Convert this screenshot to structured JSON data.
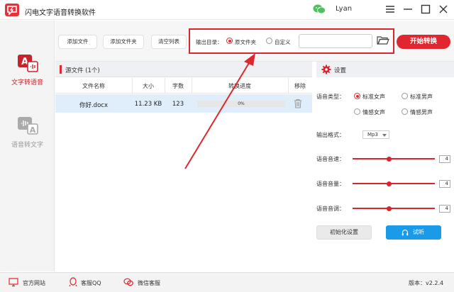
{
  "window": {
    "title": "闪电文字语音转换软件",
    "user_name": "Lyan"
  },
  "nav": {
    "items": [
      {
        "label": "文字转语音",
        "active": true
      },
      {
        "label": "语音转文字",
        "active": false
      }
    ]
  },
  "toolbar": {
    "add_file": "添加文件",
    "add_folder": "添加文件夹",
    "clear_list": "清空列表",
    "output_label": "输出目录：",
    "option_source": "原文件夹",
    "option_custom": "自定义",
    "selected_option": "原文件夹",
    "path_value": "",
    "start_label": "开始转换"
  },
  "file_panel": {
    "title": "源文件 (1个)",
    "columns": [
      "文件名称",
      "大小",
      "字数",
      "转换进度",
      "移除"
    ],
    "rows": [
      {
        "name": "你好.docx",
        "size": "11.23 KB",
        "words": "123",
        "progress": 0,
        "progress_label": "0%"
      }
    ]
  },
  "settings": {
    "title": "设置",
    "voice_type_label": "语音类型：",
    "voice_options": [
      "标准女声",
      "标准男声",
      "情感女声",
      "情感男声"
    ],
    "voice_selected": "标准女声",
    "format_label": "输出格式：",
    "format_value": "Mp3",
    "speed_label": "语音音速：",
    "speed_value": "4",
    "volume_label": "语音音量：",
    "volume_value": "4",
    "pitch_label": "语音音调：",
    "pitch_value": "4",
    "init_label": "初始化设置",
    "listen_label": "试听"
  },
  "statusbar": {
    "website": "官方网站",
    "qq": "客服QQ",
    "wechat": "微信客服",
    "version": "版本：v2.2.4"
  },
  "colors": {
    "accent_red": "#e0262f",
    "listen_blue": "#1a9bea",
    "row_selected": "#dfeefa"
  }
}
